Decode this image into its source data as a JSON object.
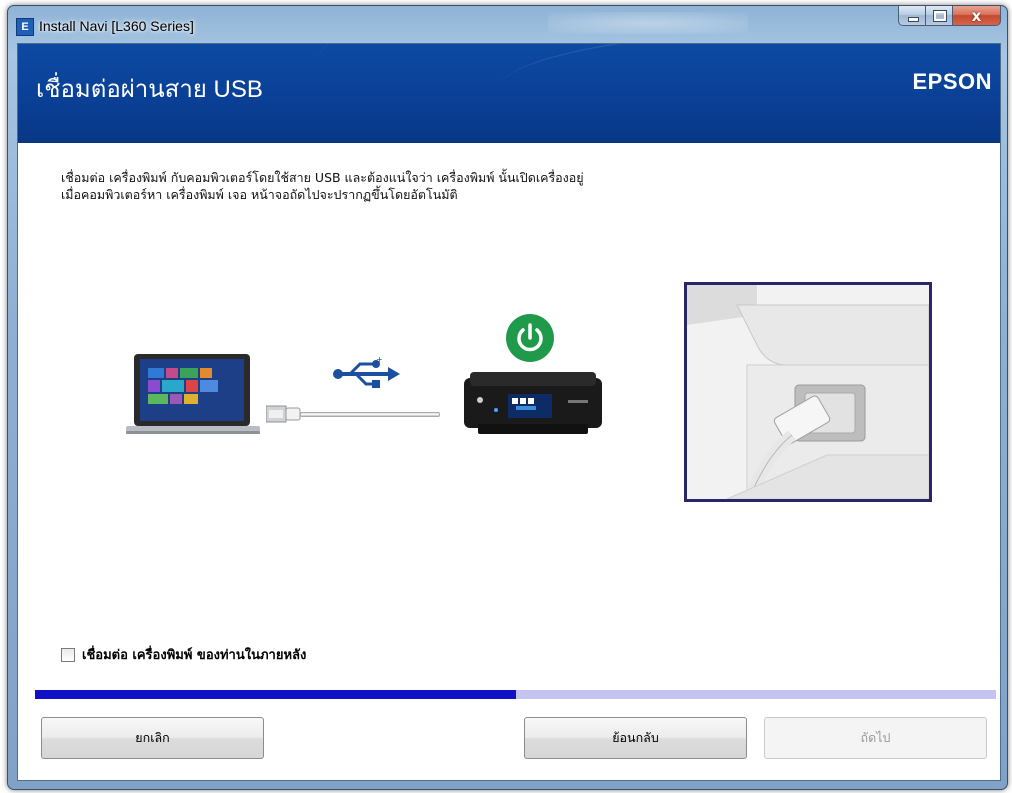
{
  "window": {
    "title": "Install Navi [L360 Series]",
    "app_icon_letter": "E",
    "controls": [
      "minimize",
      "maximize",
      "close"
    ],
    "close_symbol": "x"
  },
  "header": {
    "title": "เชื่อมต่อผ่านสาย USB",
    "brand": "EPSON",
    "background_color": "#0c479e"
  },
  "instructions": {
    "line1": "เชื่อมต่อ เครื่องพิมพ์ กับคอมพิวเตอร์โดยใช้สาย USB และต้องแน่ใจว่า เครื่องพิมพ์ นั้นเปิดเครื่องอยู่",
    "line2": "เมื่อคอมพิวเตอร์หา เครื่องพิมพ์ เจอ หน้าจอถัดไปจะปรากฏขึ้นโดยอัตโนมัติ"
  },
  "illustration": {
    "icons": [
      "laptop-icon",
      "usb-symbol-icon",
      "power-icon",
      "printer-icon",
      "usb-port-closeup"
    ],
    "power_color": "#1e9a4a",
    "usb_color": "#1b4fa0"
  },
  "background_option": {
    "label": "เชื่อมต่อ เครื่องพิมพ์ ของท่านในภายหลัง",
    "checked": false
  },
  "progress": {
    "fraction": 0.5,
    "fill_color": "#1010c6",
    "track_color": "#c5c3ef"
  },
  "buttons": {
    "cancel": "ยกเลิก",
    "back": "ย้อนกลับ",
    "next": "ถัดไป",
    "next_enabled": false
  }
}
